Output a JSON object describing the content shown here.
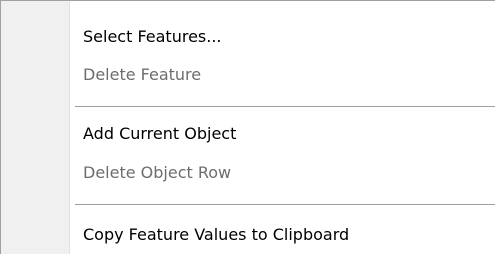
{
  "menu": {
    "items": [
      {
        "label": "Select Features...",
        "enabled": true
      },
      {
        "label": "Delete Feature",
        "enabled": false
      },
      {
        "label": "Add Current Object",
        "enabled": true
      },
      {
        "label": "Delete Object Row",
        "enabled": false
      },
      {
        "label": "Copy Feature Values to Clipboard",
        "enabled": true
      }
    ]
  },
  "colors": {
    "gutter": "#f0f0f0",
    "separator": "#a0a0a0",
    "text": "#000000",
    "disabled_text": "#6d6d6d"
  }
}
